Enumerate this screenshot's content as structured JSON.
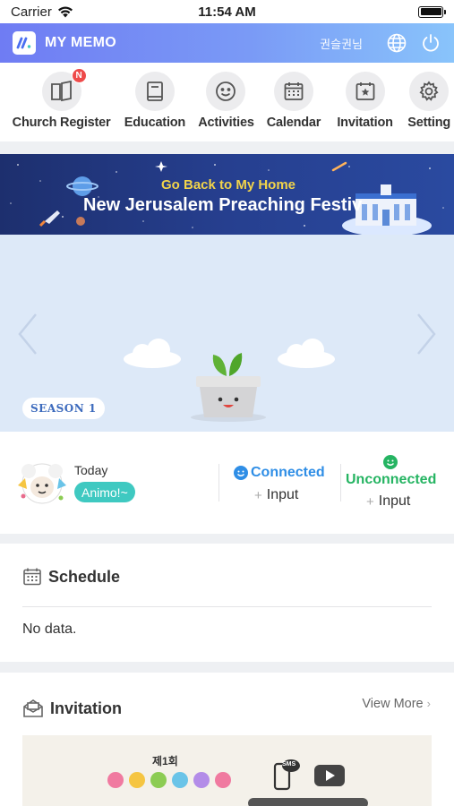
{
  "status_bar": {
    "carrier": "Carrier",
    "time": "11:54 AM"
  },
  "header": {
    "logo": "M",
    "title": "MY MEMO",
    "user": "권슬권님"
  },
  "menu": [
    {
      "label": "Church Register",
      "icon": "book-icon",
      "badge": "N"
    },
    {
      "label": "Education",
      "icon": "bible-icon"
    },
    {
      "label": "Activities",
      "icon": "smile-icon"
    },
    {
      "label": "Calendar",
      "icon": "calendar-icon"
    },
    {
      "label": "Invitation",
      "icon": "invitation-icon"
    },
    {
      "label": "Setting",
      "icon": "gear-icon"
    }
  ],
  "banner": {
    "subtitle": "Go Back to My Home",
    "title": "New Jerusalem Preaching Festiv"
  },
  "hero": {
    "season": "SEASON 1"
  },
  "today": {
    "label": "Today",
    "status": "Animo!~",
    "connected": {
      "title": "Connected",
      "input": "Input"
    },
    "unconnected": {
      "title": "Unconnected",
      "input": "Input"
    }
  },
  "schedule": {
    "title": "Schedule",
    "empty": "No data."
  },
  "invitation": {
    "title": "Invitation",
    "view_more": "View More",
    "image_text": "제1회",
    "sms_label": "SMS"
  },
  "colors": {
    "header_start": "#6f7cf3",
    "header_end": "#89c4fb",
    "connected": "#2f8ee6",
    "unconnected": "#25b462",
    "animo": "#3fc9c1",
    "badge": "#ee4a4a"
  }
}
